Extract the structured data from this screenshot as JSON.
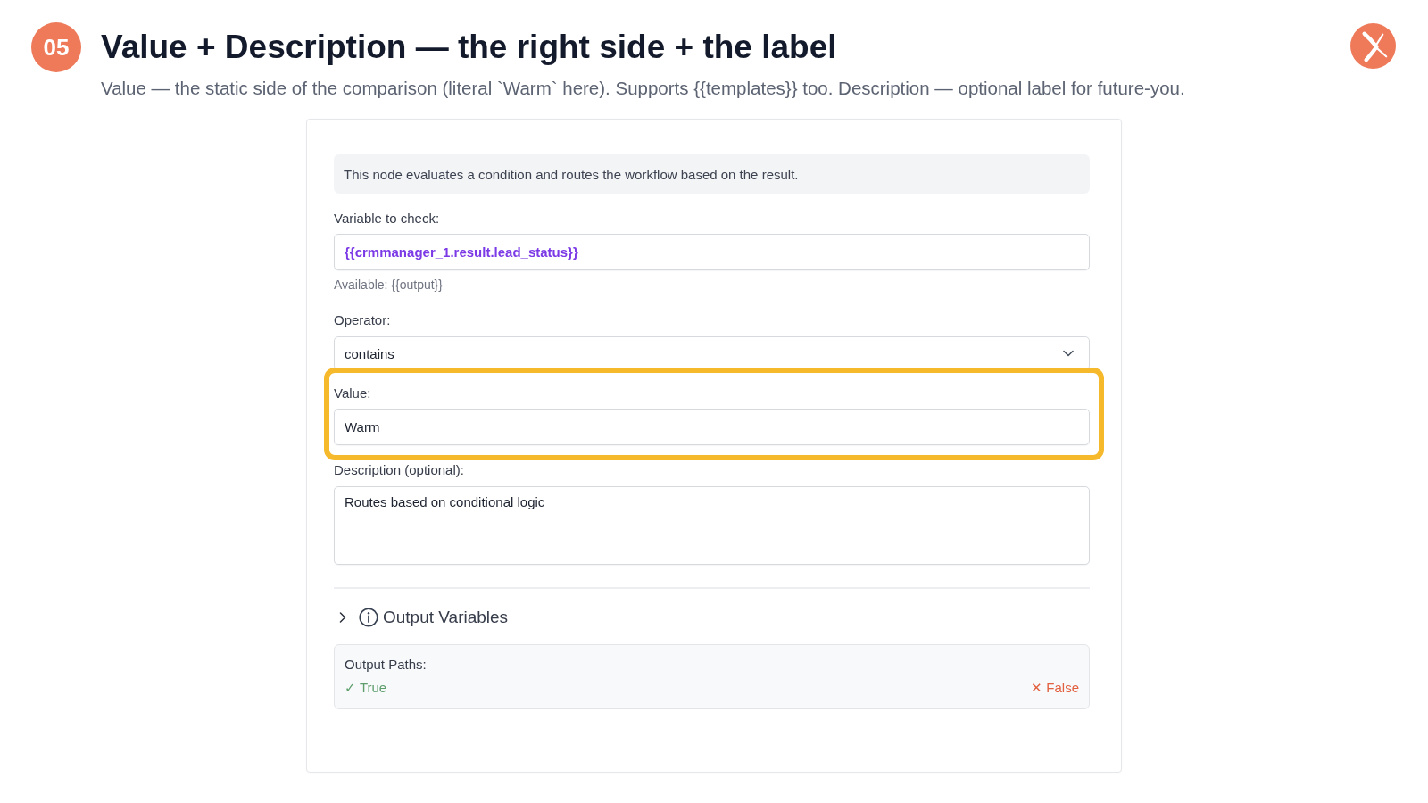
{
  "header": {
    "step_badge": "05",
    "title": "Value + Description — the right side + the label",
    "subtitle": "Value — the static side of the comparison (literal `Warm` here). Supports {{templates}} too. Description — optional label for future-you."
  },
  "panel": {
    "info_text": "This node evaluates a condition and routes the workflow based on the result.",
    "fields": [
      {
        "kind": "variable",
        "label": "Variable to check:",
        "value": "{{crmmanager_1.result.lead_status}}",
        "helper": "Available: {{output}}",
        "highlighted": false
      },
      {
        "kind": "select",
        "label": "Operator:",
        "value": "contains",
        "highlighted": false
      },
      {
        "kind": "text",
        "label": "Value:",
        "value": "Warm",
        "highlighted": true
      },
      {
        "kind": "textarea",
        "label": "Description (optional):",
        "value": "Routes based on conditional logic",
        "highlighted": false
      }
    ],
    "output_variables": {
      "label": "Output Variables",
      "expanded": false
    },
    "output_paths": {
      "label": "Output Paths:",
      "paths": [
        {
          "kind": "true",
          "label": "✓ True"
        },
        {
          "kind": "false",
          "label": "✕ False"
        }
      ]
    }
  }
}
